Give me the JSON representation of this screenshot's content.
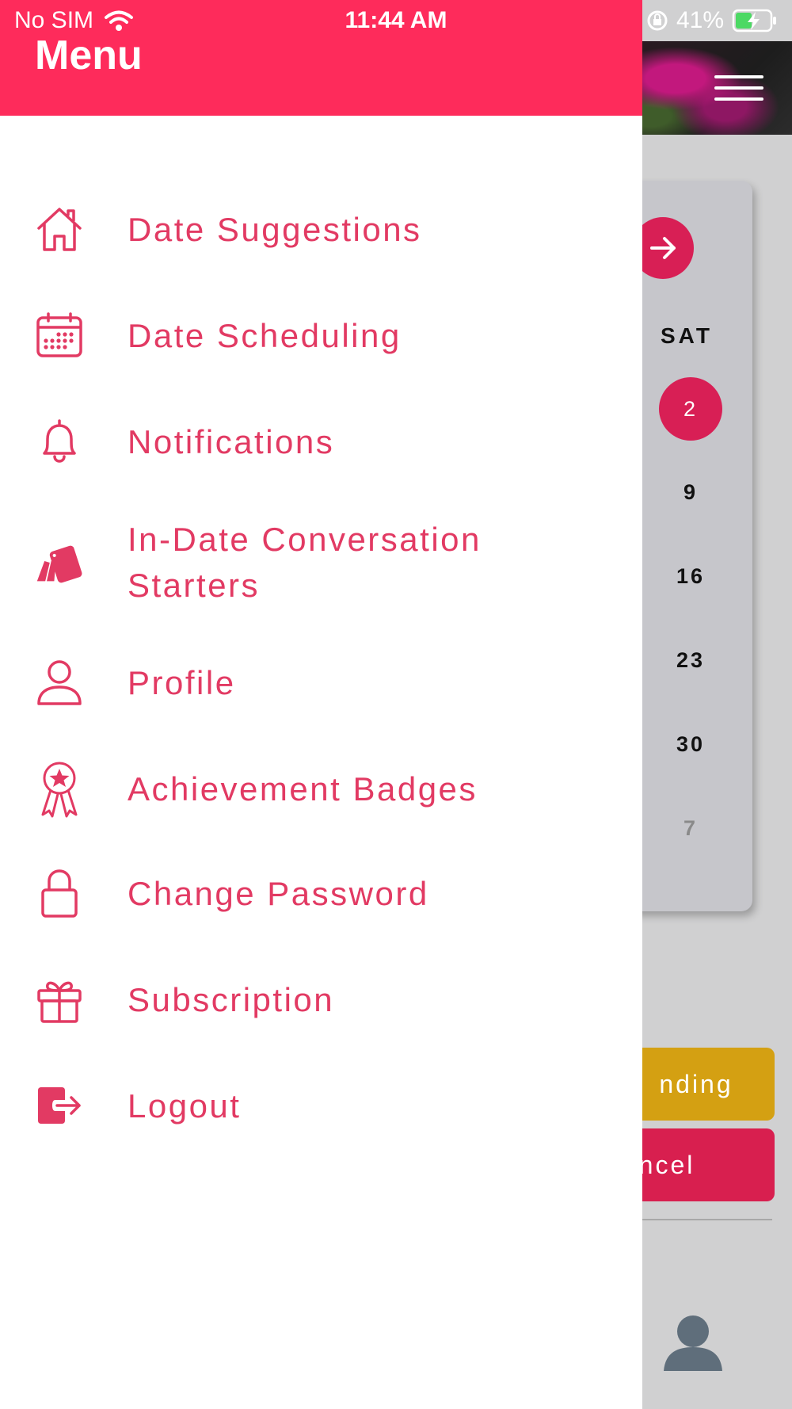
{
  "status_bar": {
    "carrier": "No SIM",
    "time": "11:44 AM",
    "battery": "41%"
  },
  "drawer": {
    "title": "Menu",
    "items": [
      {
        "label": "Date Suggestions",
        "icon": "home-icon"
      },
      {
        "label": "Date Scheduling",
        "icon": "calendar-icon"
      },
      {
        "label": "Notifications",
        "icon": "bell-icon"
      },
      {
        "label": "In-Date Conversation Starters",
        "icon": "cards-icon"
      },
      {
        "label": "Profile",
        "icon": "user-icon"
      },
      {
        "label": "Achievement Badges",
        "icon": "badge-icon"
      },
      {
        "label": "Change Password",
        "icon": "lock-icon"
      },
      {
        "label": "Subscription",
        "icon": "gift-icon"
      },
      {
        "label": "Logout",
        "icon": "logout-icon"
      }
    ]
  },
  "background": {
    "weekday": "SAT",
    "days": [
      "2",
      "9",
      "16",
      "23",
      "30",
      "7"
    ],
    "selected_day": "2",
    "pending_label": "nding",
    "cancel_label": "ncel"
  },
  "colors": {
    "accent": "#fe2b5b",
    "menu_text": "#e23a63",
    "pending": "#d4a012",
    "cancel": "#d81f4f"
  }
}
